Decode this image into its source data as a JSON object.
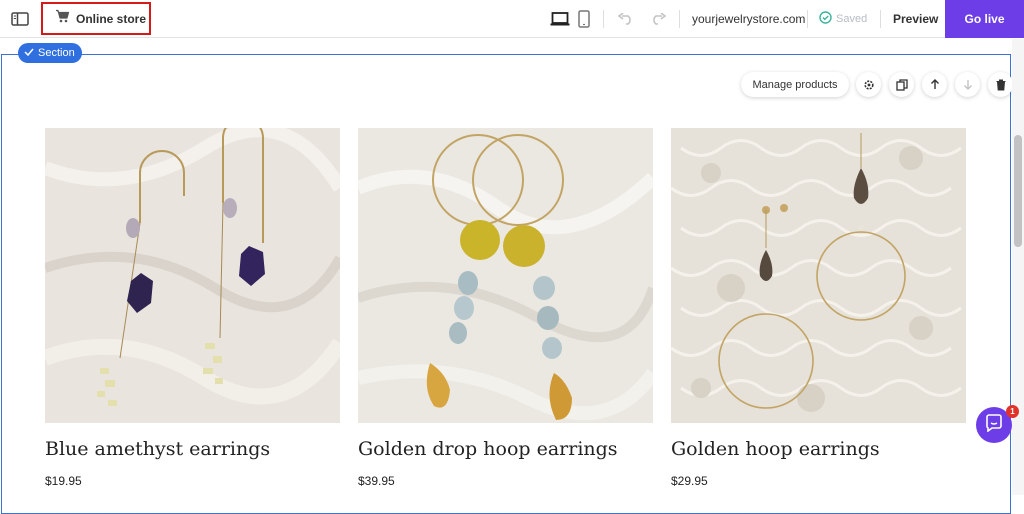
{
  "topbar": {
    "store_label": "Online store",
    "domain": "yourjewelrystore.com",
    "saved_label": "Saved",
    "preview_label": "Preview",
    "golive_label": "Go live",
    "accent_color": "#6d3ee8"
  },
  "section": {
    "badge_label": "Section",
    "toolbar": {
      "manage_label": "Manage products",
      "icons": [
        "gear-icon",
        "duplicate-icon",
        "arrow-up-icon",
        "arrow-down-icon",
        "trash-icon"
      ]
    }
  },
  "products": [
    {
      "title": "Blue amethyst earrings",
      "price": "$19.95"
    },
    {
      "title": "Golden drop hoop earrings",
      "price": "$39.95"
    },
    {
      "title": "Golden hoop earrings",
      "price": "$29.95"
    }
  ],
  "chat": {
    "badge_count": "1"
  }
}
